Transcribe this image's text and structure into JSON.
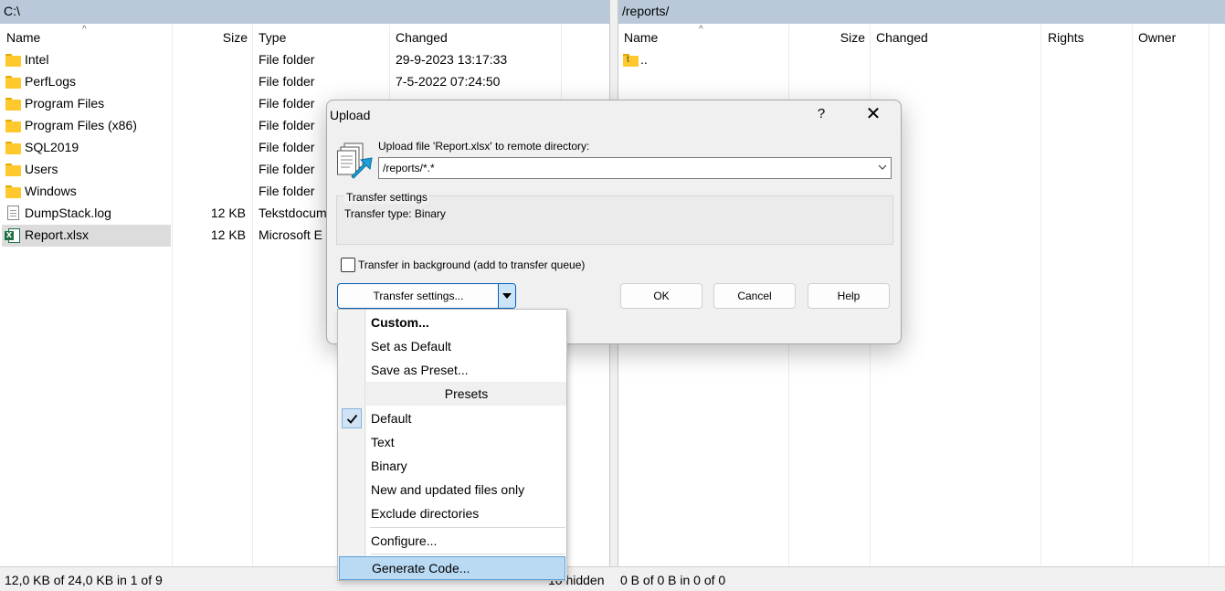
{
  "left_panel": {
    "path": "C:\\",
    "columns": {
      "name": "Name",
      "size": "Size",
      "type": "Type",
      "changed": "Changed"
    },
    "rows": [
      {
        "icon": "folder-icon",
        "name": "Intel",
        "size": "",
        "type": "File folder",
        "changed": "29-9-2023 13:17:33"
      },
      {
        "icon": "folder-icon",
        "name": "PerfLogs",
        "size": "",
        "type": "File folder",
        "changed": "7-5-2022 07:24:50"
      },
      {
        "icon": "folder-icon",
        "name": "Program Files",
        "size": "",
        "type": "File folder",
        "changed": ""
      },
      {
        "icon": "folder-icon",
        "name": "Program Files (x86)",
        "size": "",
        "type": "File folder",
        "changed": ""
      },
      {
        "icon": "folder-icon",
        "name": "SQL2019",
        "size": "",
        "type": "File folder",
        "changed": ""
      },
      {
        "icon": "folder-icon",
        "name": "Users",
        "size": "",
        "type": "File folder",
        "changed": ""
      },
      {
        "icon": "folder-icon",
        "name": "Windows",
        "size": "",
        "type": "File folder",
        "changed": ""
      },
      {
        "icon": "text-file-icon",
        "name": "DumpStack.log",
        "size": "12 KB",
        "type": "Tekstdocum",
        "changed": ""
      },
      {
        "icon": "excel-file-icon",
        "name": "Report.xlsx",
        "size": "12 KB",
        "type": "Microsoft E",
        "changed": ""
      }
    ],
    "status": "12,0 KB of 24,0 KB in 1 of 9",
    "hidden": "10 hidden"
  },
  "right_panel": {
    "path": "/reports/",
    "columns": {
      "name": "Name",
      "size": "Size",
      "changed": "Changed",
      "rights": "Rights",
      "owner": "Owner"
    },
    "rows": [
      {
        "icon": "parent-directory-icon",
        "name": ".."
      }
    ],
    "status": "0 B of 0 B in 0 of 0"
  },
  "dialog": {
    "title": "Upload",
    "help_glyph": "?",
    "close_glyph": "✕",
    "prompt": "Upload file 'Report.xlsx' to remote directory:",
    "target": "/reports/*.*",
    "group_title": "Transfer settings",
    "transfer_type": "Transfer type: Binary",
    "background_checkbox": {
      "label": "Transfer in background (add to transfer queue)",
      "checked": false
    },
    "transfer_settings_button": "Transfer settings...",
    "ok_button": "OK",
    "cancel_button": "Cancel",
    "help_button": "Help"
  },
  "menu": {
    "custom": "Custom...",
    "set_default": "Set as Default",
    "save_preset": "Save as Preset...",
    "presets_header": "Presets",
    "presets": [
      {
        "label": "Default",
        "checked": true
      },
      {
        "label": "Text",
        "checked": false
      },
      {
        "label": "Binary",
        "checked": false
      },
      {
        "label": "New and updated files only",
        "checked": false
      },
      {
        "label": "Exclude directories",
        "checked": false
      }
    ],
    "configure": "Configure...",
    "generate_code": "Generate Code..."
  },
  "colors": {
    "path_bar": "#b9c9d9",
    "selection": "#dcdcdc",
    "menu_highlight": "#bad9f3",
    "accent": "#005fb8"
  }
}
